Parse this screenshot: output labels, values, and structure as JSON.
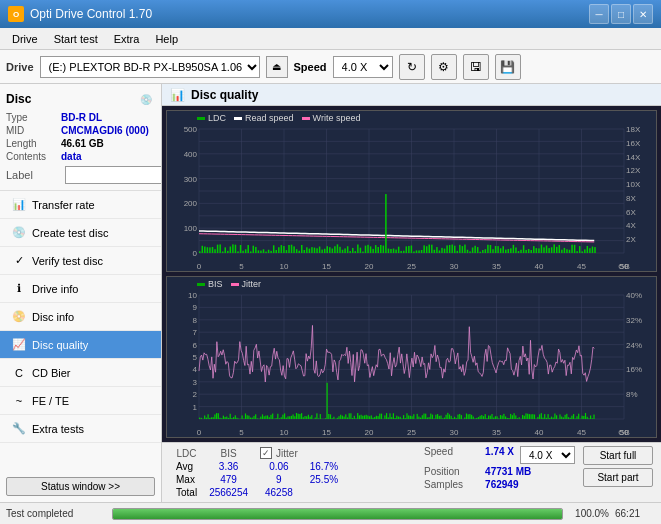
{
  "titlebar": {
    "title": "Opti Drive Control 1.70",
    "minimize": "─",
    "maximize": "□",
    "close": "✕"
  },
  "menu": {
    "items": [
      "Drive",
      "Start test",
      "Extra",
      "Help"
    ]
  },
  "toolbar": {
    "drive_label": "Drive",
    "drive_value": "(E:)  PLEXTOR BD-R  PX-LB950SA 1.06",
    "speed_label": "Speed",
    "speed_value": "4.0 X"
  },
  "disc": {
    "header": "Disc",
    "type_label": "Type",
    "type_value": "BD-R DL",
    "mid_label": "MID",
    "mid_value": "CMCMAGDI6 (000)",
    "length_label": "Length",
    "length_value": "46.61 GB",
    "contents_label": "Contents",
    "contents_value": "data",
    "label_label": "Label",
    "label_value": ""
  },
  "nav": {
    "items": [
      {
        "id": "transfer-rate",
        "label": "Transfer rate",
        "icon": "📊"
      },
      {
        "id": "create-test-disc",
        "label": "Create test disc",
        "icon": "💿"
      },
      {
        "id": "verify-test-disc",
        "label": "Verify test disc",
        "icon": "✅"
      },
      {
        "id": "drive-info",
        "label": "Drive info",
        "icon": "ℹ️"
      },
      {
        "id": "disc-info",
        "label": "Disc info",
        "icon": "📀"
      },
      {
        "id": "disc-quality",
        "label": "Disc quality",
        "icon": "📈",
        "active": true
      },
      {
        "id": "cd-bier",
        "label": "CD Bier",
        "icon": "🍺"
      },
      {
        "id": "fe-te",
        "label": "FE / TE",
        "icon": "📉"
      },
      {
        "id": "extra-tests",
        "label": "Extra tests",
        "icon": "🔧"
      }
    ],
    "status_btn": "Status window >>"
  },
  "chart": {
    "title": "Disc quality",
    "top": {
      "legend": [
        {
          "label": "LDC",
          "color": "#00aa00"
        },
        {
          "label": "Read speed",
          "color": "#ffffff"
        },
        {
          "label": "Write speed",
          "color": "#ff69b4"
        }
      ],
      "y_max_left": 500,
      "y_max_right": 18,
      "y_right_labels": [
        "18X",
        "16X",
        "14X",
        "12X",
        "10X",
        "8X",
        "6X",
        "4X",
        "2X"
      ],
      "x_max": 50
    },
    "bottom": {
      "legend": [
        {
          "label": "BIS",
          "color": "#00aa00"
        },
        {
          "label": "Jitter",
          "color": "#ff69b4"
        }
      ],
      "y_max_left": 10,
      "y_right_labels": [
        "40%",
        "32%",
        "24%",
        "16%",
        "8%"
      ],
      "x_max": 50
    }
  },
  "stats": {
    "headers": [
      "LDC",
      "BIS",
      "",
      "Jitter",
      "Speed",
      ""
    ],
    "avg": {
      "ldc": "3.36",
      "bis": "0.06",
      "jitter": "16.7%"
    },
    "max": {
      "ldc": "479",
      "bis": "9",
      "jitter": "25.5%"
    },
    "total": {
      "ldc": "2566254",
      "bis": "46258"
    },
    "speed_label": "Speed",
    "speed_value": "1.74 X",
    "speed_select": "4.0 X",
    "position_label": "Position",
    "position_value": "47731 MB",
    "samples_label": "Samples",
    "samples_value": "762949",
    "jitter_checked": true,
    "btn_start_full": "Start full",
    "btn_start_part": "Start part"
  },
  "statusbar": {
    "text": "Test completed",
    "progress": 100,
    "progress_text": "100.0%",
    "time": "66:21"
  }
}
